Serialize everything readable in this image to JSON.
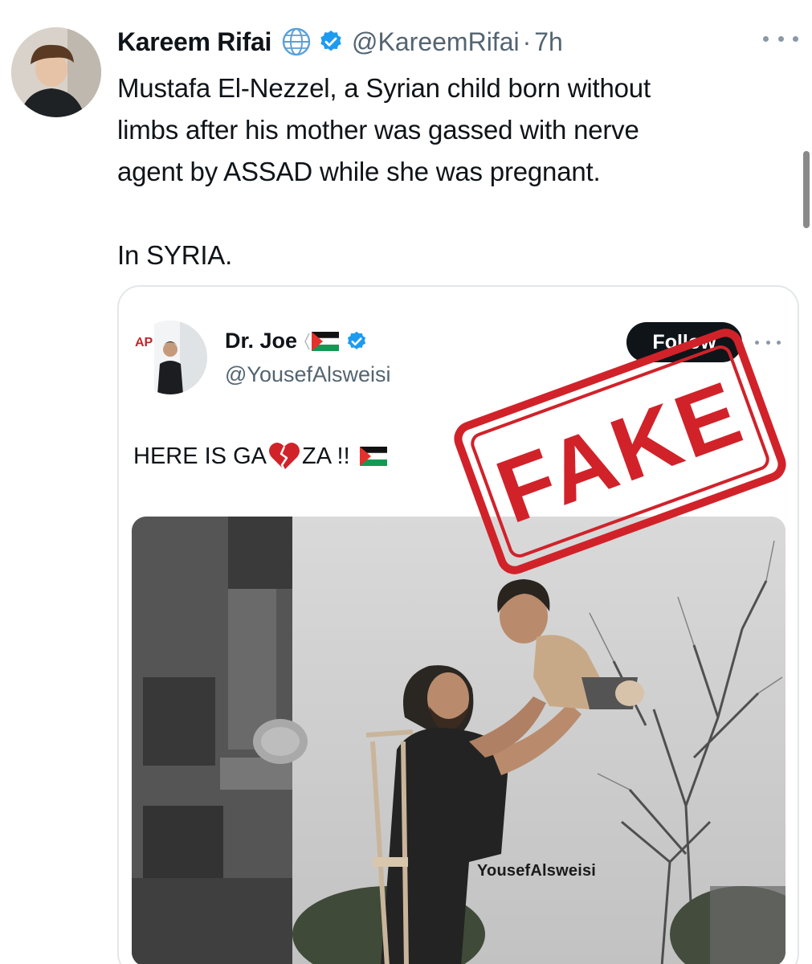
{
  "tweet": {
    "author_name": "Kareem Rifai",
    "handle": "@KareemRifai",
    "separator": "·",
    "time": "7h",
    "lines": [
      "Mustafa El-Nezzel, a Syrian child born without",
      "limbs after his mother was gassed with nerve",
      "agent by ASSAD while she was pregnant."
    ],
    "line_last": "In SYRIA.",
    "icons": [
      "globe-icon",
      "verified-badge-icon",
      "more-icon"
    ]
  },
  "quote": {
    "author_name": "Dr. Joe",
    "handle": "@YousefAlsweisi",
    "follow_label": "Follow",
    "text_part1": "HERE IS GA",
    "text_part2": "ZA !!",
    "photo_watermark": "YousefAlsweisi",
    "avatar_badge_text": "AP",
    "icons": [
      "palestine-flag-icon",
      "verified-badge-icon",
      "broken-heart-icon",
      "more-icon"
    ]
  },
  "stamp": {
    "text": "FAKE",
    "color": "#d1222a"
  },
  "colors": {
    "verified_blue": "#1d9bf0",
    "secondary_text": "#536471",
    "follow_bg": "#0f1419"
  }
}
